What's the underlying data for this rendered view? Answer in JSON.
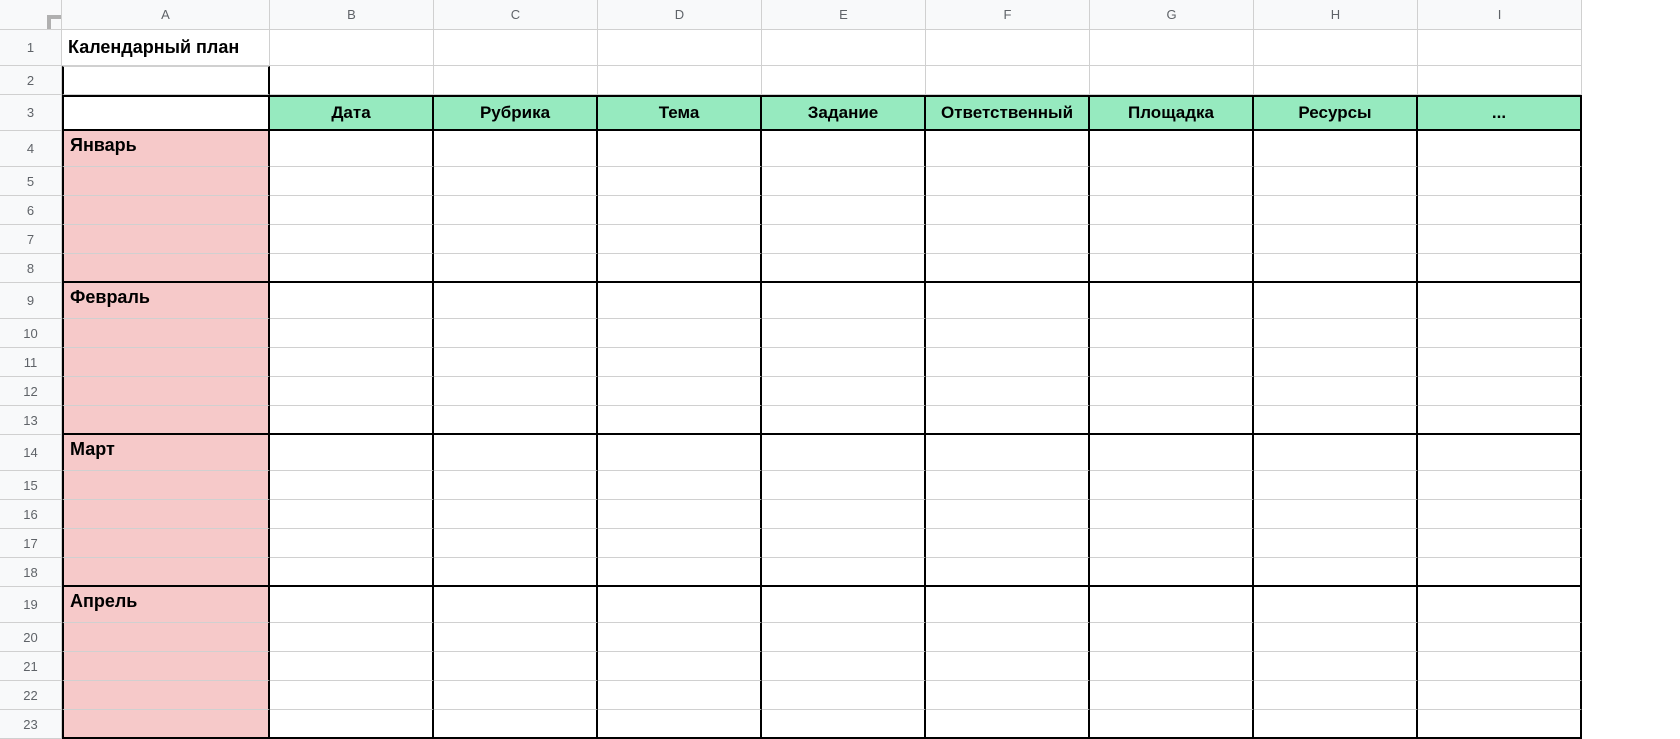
{
  "columns": [
    "A",
    "B",
    "C",
    "D",
    "E",
    "F",
    "G",
    "H",
    "I"
  ],
  "rows": [
    1,
    2,
    3,
    4,
    5,
    6,
    7,
    8,
    9,
    10,
    11,
    12,
    13,
    14,
    15,
    16,
    17,
    18,
    19,
    20,
    21,
    22,
    23
  ],
  "title": "Календарный план",
  "headers": {
    "b": "Дата",
    "c": "Рубрика",
    "d": "Тема",
    "e": "Задание",
    "f": "Ответственный",
    "g": "Площадка",
    "h": "Ресурсы",
    "i": "..."
  },
  "months": {
    "jan": "Январь",
    "feb": "Февраль",
    "mar": "Март",
    "apr": "Апрель"
  }
}
